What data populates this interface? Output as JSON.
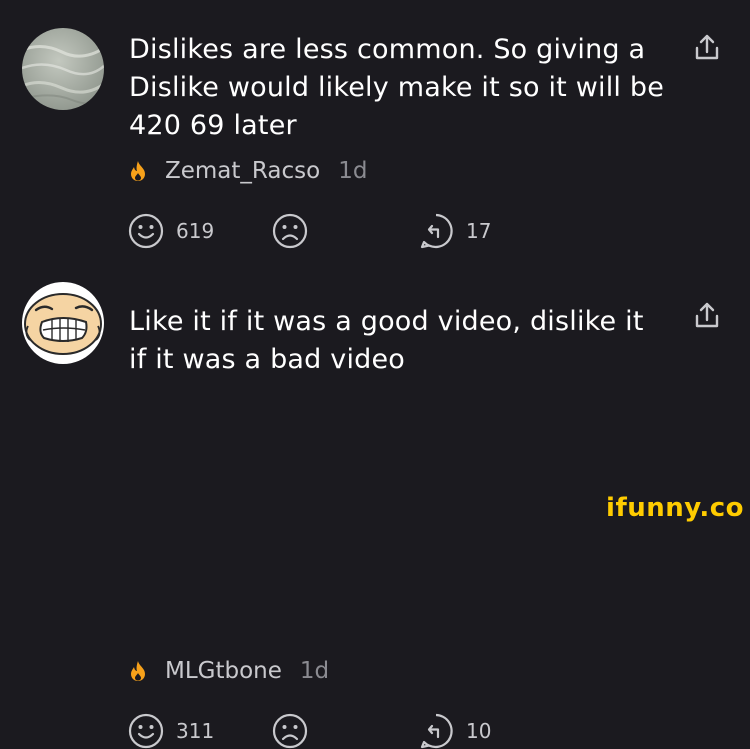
{
  "comments": [
    {
      "text": "Dislikes are less common. So giving a Dislike would likely make it so it will be 420 69 later",
      "username": "Zemat_Racso",
      "time": "1d",
      "like_count": "619",
      "reply_count": "17",
      "avatar_icon": "avatar-texture",
      "badge_icon": "fire-icon"
    },
    {
      "text": "Like it if it was a good video, dislike it if it was a bad video",
      "username": "MLGtbone",
      "time": "1d",
      "like_count": "311",
      "reply_count": "10",
      "avatar_icon": "avatar-cartoon-face",
      "badge_icon": "fire-icon"
    }
  ],
  "watermark": "ifunny.co",
  "colors": {
    "background": "#1b1a1f",
    "text": "#ffffff",
    "muted": "#8b8b91",
    "fire": "#f7a11a",
    "watermark": "#ffcc00"
  }
}
